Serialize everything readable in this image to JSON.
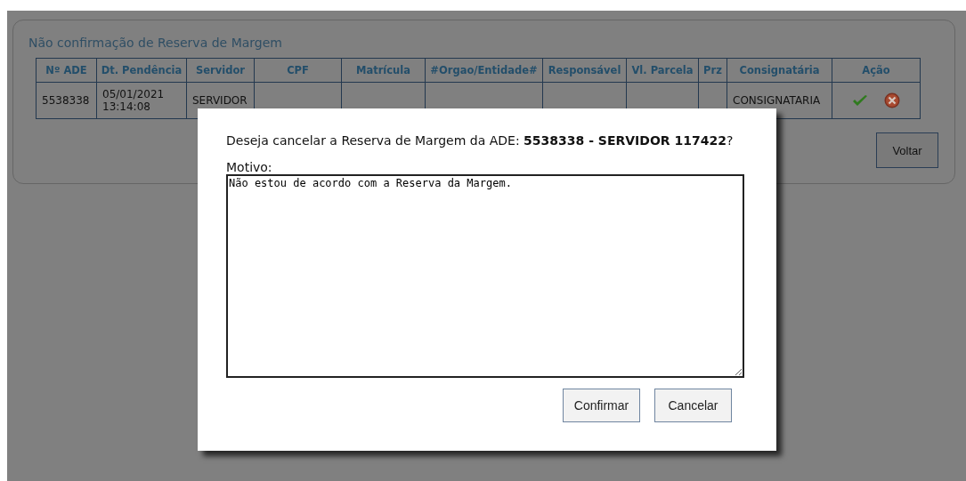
{
  "panel": {
    "title": "Não confirmação de Reserva de Margem",
    "table": {
      "columns": [
        "Nº ADE",
        "Dt. Pendência",
        "Servidor",
        "CPF",
        "Matrícula",
        "#Orgao/Entidade#",
        "Responsável",
        "Vl. Parcela",
        "Prz",
        "Consignatária",
        "Ação"
      ],
      "rows": [
        {
          "ade": "5538338",
          "pendencia": "05/01/2021 13:14:08",
          "servidor": "SERVIDOR",
          "consignataria": "CONSIGNATARIA"
        }
      ]
    },
    "back_button": "Voltar"
  },
  "dialog": {
    "message": "Deseja cancelar a Reserva de Margem da ADE: **5538338 - SERVIDOR 117422**?",
    "reason_label": "Motivo:",
    "reason_value": "Não estou de acordo com a Reserva da Margem.",
    "buttons": [
      "Confirmar",
      "Cancelar"
    ]
  }
}
